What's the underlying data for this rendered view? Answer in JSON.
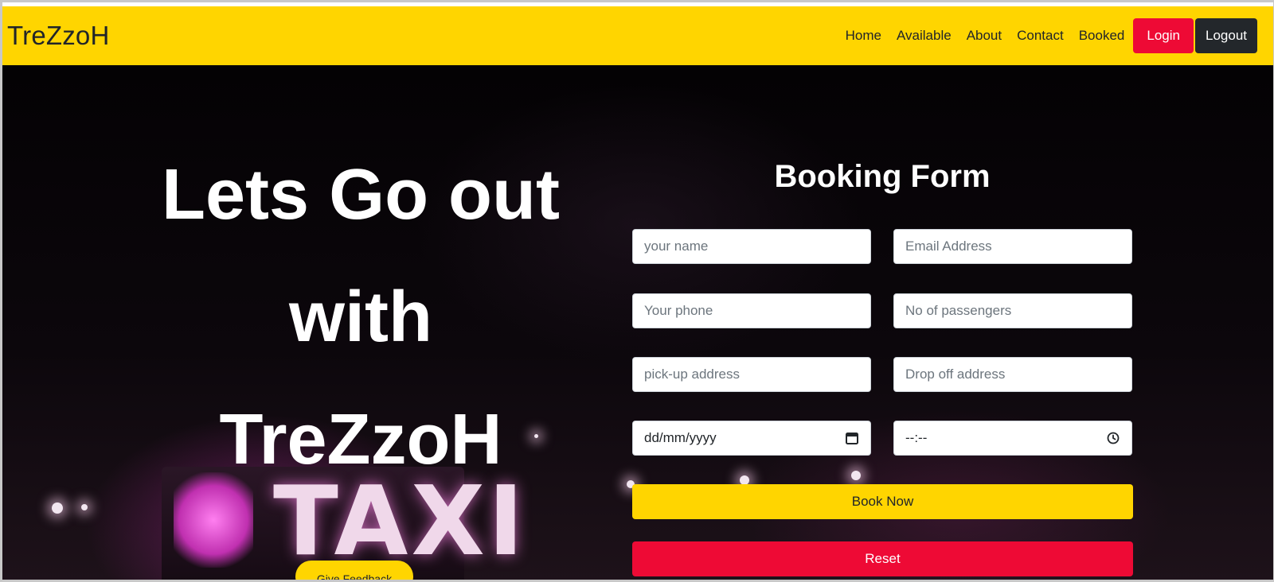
{
  "navbar": {
    "brand": "TreZzoH",
    "links": [
      "Home",
      "Available",
      "About",
      "Contact",
      "Booked"
    ],
    "login_label": "Login",
    "logout_label": "Logout"
  },
  "hero": {
    "headline_lines": [
      "Lets Go out",
      "with",
      "TreZzoH"
    ],
    "feedback_label": "Give Feedback",
    "sign_text": "TAXI"
  },
  "booking_form": {
    "title": "Booking Form",
    "fields": {
      "name": "your name",
      "email": "Email Address",
      "phone": "Your phone",
      "passengers": "No of passengers",
      "pickup": "pick-up address",
      "dropoff": "Drop off address",
      "date": "dd/mm/yyyy",
      "time": "--:--"
    },
    "book_label": "Book Now",
    "reset_label": "Reset"
  },
  "colors": {
    "navbar_bg": "#ffd500",
    "login_bg": "#ee0a35",
    "logout_bg": "#23272b",
    "book_bg": "#ffd500",
    "reset_bg": "#ee0a35"
  },
  "icons": {
    "date": "calendar-icon",
    "time": "clock-icon"
  }
}
